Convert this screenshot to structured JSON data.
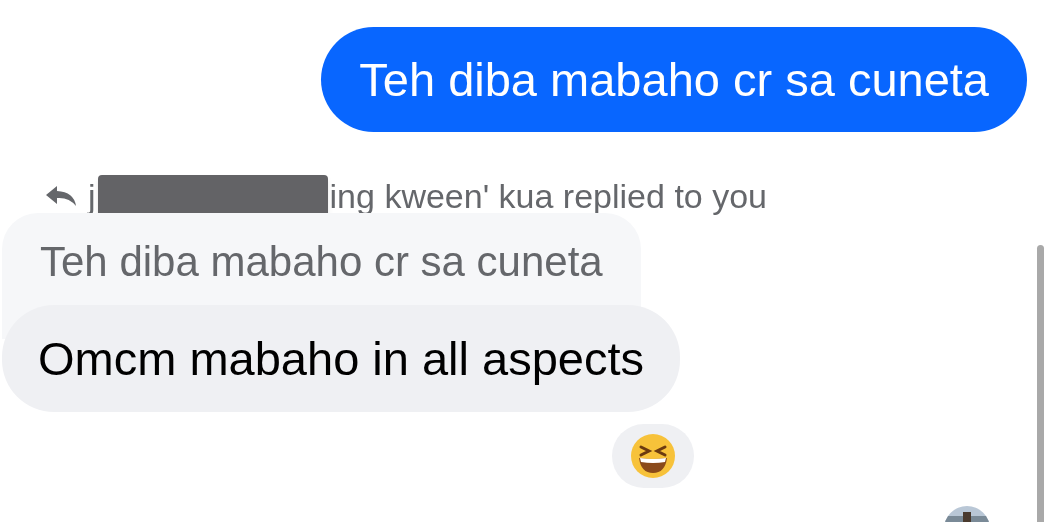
{
  "sent_message": {
    "text": "Teh diba mabaho cr sa cuneta"
  },
  "reply_label": {
    "before_redaction": "j",
    "after_redaction": "ing kween' kua replied to you",
    "redacted": true
  },
  "quoted_message": {
    "text": "Teh diba mabaho cr sa cuneta"
  },
  "received_message": {
    "text": "Omcm mabaho in all aspects"
  },
  "reaction": {
    "kind": "laughing"
  }
}
